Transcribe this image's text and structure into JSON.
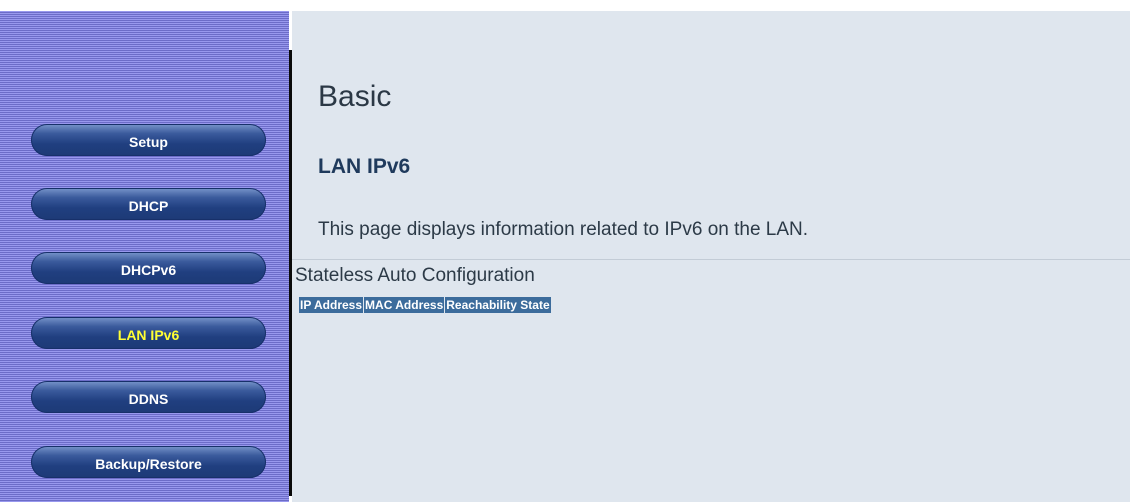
{
  "sidebar": {
    "items": [
      {
        "label": "Setup",
        "active": false
      },
      {
        "label": "DHCP",
        "active": false
      },
      {
        "label": "DHCPv6",
        "active": false
      },
      {
        "label": "LAN IPv6",
        "active": true
      },
      {
        "label": "DDNS",
        "active": false
      },
      {
        "label": "Backup/Restore",
        "active": false
      }
    ]
  },
  "main": {
    "title": "Basic",
    "section_title": "LAN IPv6",
    "description": "This page displays information related to IPv6 on the LAN.",
    "subsection_label": "Stateless Auto Configuration",
    "table": {
      "columns": [
        "IP Address",
        "MAC Address",
        "Reachability State"
      ],
      "rows": []
    }
  },
  "colors": {
    "active_nav_text": "#ffff33",
    "nav_text": "#ffffff",
    "table_header_bg": "#3c6c9c",
    "content_bg": "#dfe6ee"
  }
}
